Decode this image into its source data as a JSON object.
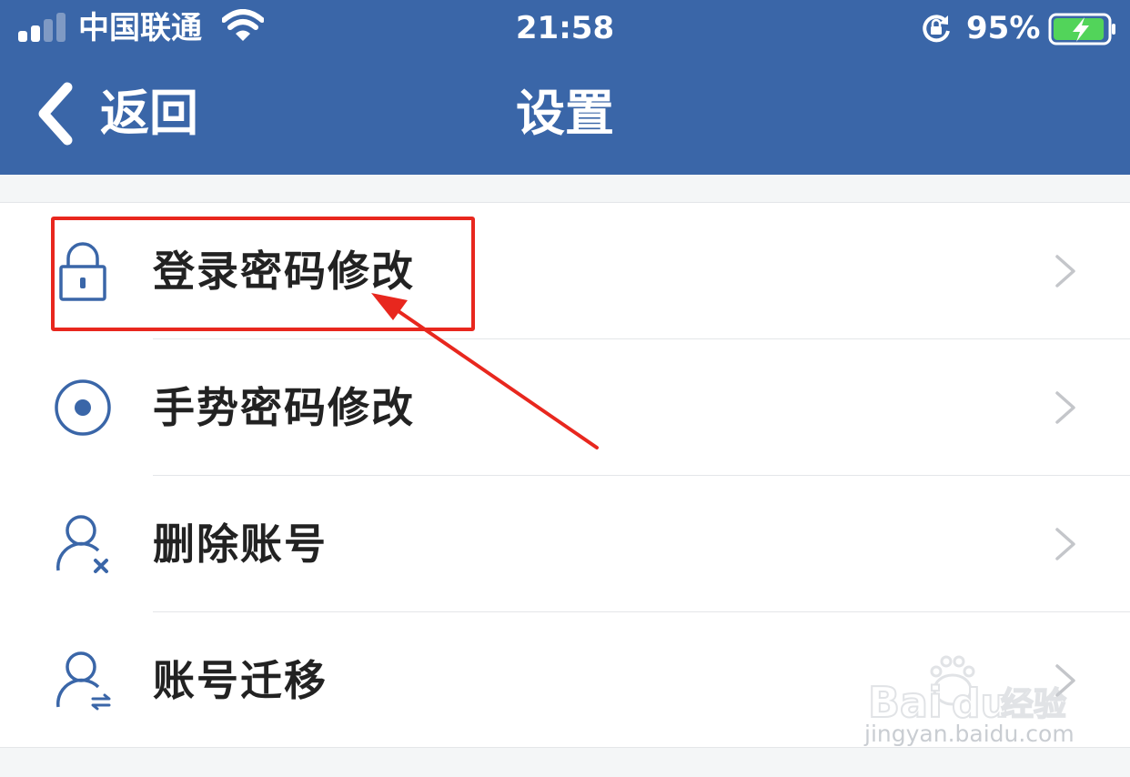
{
  "status_bar": {
    "carrier": "中国联通",
    "time": "21:58",
    "battery_percent": "95%",
    "battery_level": 0.95,
    "icons": [
      "signal-icon",
      "wifi-icon",
      "rotation-lock-icon",
      "battery-charging-icon"
    ]
  },
  "nav": {
    "back_label": "返回",
    "title": "设置"
  },
  "settings": {
    "items": [
      {
        "label": "登录密码修改",
        "icon": "lock-icon"
      },
      {
        "label": "手势密码修改",
        "icon": "gesture-dot-icon"
      },
      {
        "label": "删除账号",
        "icon": "user-remove-icon"
      },
      {
        "label": "账号迁移",
        "icon": "user-transfer-icon"
      }
    ]
  },
  "annotation": {
    "highlighted_item": "登录密码修改",
    "color": "#e8271e"
  },
  "watermark": {
    "brand": "Baidu经验",
    "url": "jingyan.baidu.com"
  },
  "colors": {
    "header_bg": "#3a66a8",
    "icon_blue": "#3a66a8",
    "battery_green": "#52d45a"
  }
}
